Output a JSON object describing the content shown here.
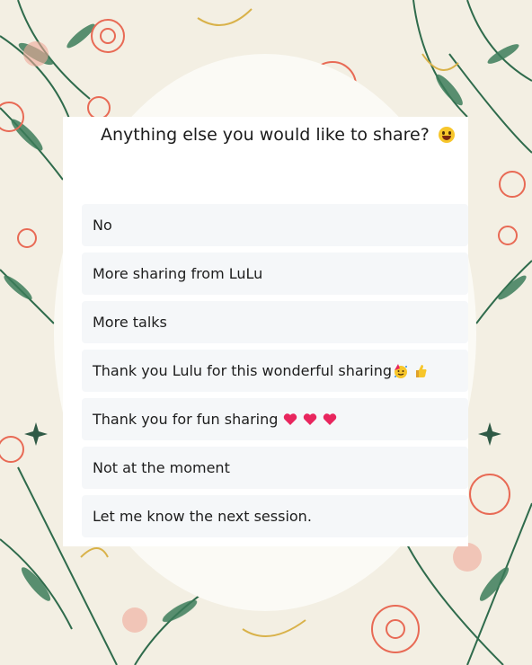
{
  "survey": {
    "question": "Anything else you would like to share?",
    "question_emoji": "grinning-face-icon",
    "options": [
      {
        "label": "No",
        "emojis": []
      },
      {
        "label": "More sharing from LuLu",
        "emojis": []
      },
      {
        "label": "More talks",
        "emojis": []
      },
      {
        "label": "Thank you Lulu for this wonderful sharing",
        "emojis": [
          "party-face-icon",
          "thumbs-up-icon"
        ]
      },
      {
        "label": "Thank you for fun sharing",
        "emojis": [
          "heart-icon",
          "heart-icon",
          "heart-icon"
        ]
      },
      {
        "label": "Not at the moment",
        "emojis": []
      },
      {
        "label": "Let me know the next session.",
        "emojis": []
      }
    ]
  },
  "colors": {
    "background": "#f3efe3",
    "card": "#ffffff",
    "option_background": "#f5f7f9",
    "flower_coral": "#e86a55",
    "leaf_green": "#2f6b4c",
    "heart": "#e8265e"
  }
}
